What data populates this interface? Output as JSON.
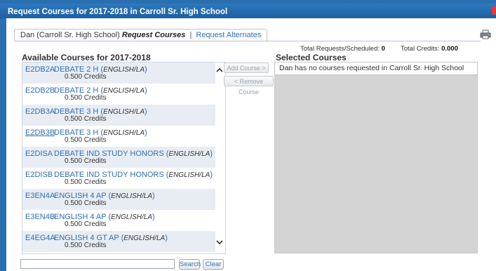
{
  "window": {
    "title": "Request Courses for 2017-2018 in Carroll Sr. High School"
  },
  "tabs": {
    "user_label": "Dan (Carroll Sr. High School)",
    "active_label": "Request Courses",
    "separator": "|",
    "alt_label": "Request Alternates"
  },
  "totals": {
    "requests_label": "Total Requests/Scheduled:",
    "requests_value": "0",
    "credits_label": "Total Credits:",
    "credits_value": "0.000"
  },
  "available": {
    "heading": "Available Courses for 2017-2018",
    "courses": [
      {
        "code": "E2DB2A",
        "name": "DEBATE 2 H",
        "dept": "ENGLISH/LA",
        "credits": "0.500 Credits"
      },
      {
        "code": "E2DB2B",
        "name": "DEBATE 2 H",
        "dept": "ENGLISH/LA",
        "credits": "0.500 Credits"
      },
      {
        "code": "E2DB3A",
        "name": "DEBATE 3 H",
        "dept": "ENGLISH/LA",
        "credits": "0.500 Credits"
      },
      {
        "code": "E2DB3B",
        "name": "DEBATE 3 H",
        "dept": "ENGLISH/LA",
        "credits": "0.500 Credits"
      },
      {
        "code": "E2DISA",
        "name": "DEBATE IND STUDY HONORS",
        "dept": "ENGLISH/LA",
        "credits": "0.500 Credits"
      },
      {
        "code": "E2DISB",
        "name": "DEBATE IND STUDY HONORS",
        "dept": "ENGLISH/LA",
        "credits": "0.500 Credits"
      },
      {
        "code": "E3EN4A",
        "name": "ENGLISH 4 AP",
        "dept": "ENGLISH/LA",
        "credits": "0.500 Credits"
      },
      {
        "code": "E3EN4B",
        "name": "ENGLISH 4 AP",
        "dept": "ENGLISH/LA",
        "credits": "0.500 Credits"
      },
      {
        "code": "E4EG4A",
        "name": "ENGLISH 4 GT AP",
        "dept": "ENGLISH/LA",
        "credits": "0.500 Credits"
      }
    ]
  },
  "actions": {
    "add": "Add Course >",
    "remove": "< Remove Course"
  },
  "selected": {
    "heading": "Selected Courses",
    "empty_message": "Dan has no courses requested in Carroll Sr. High School"
  },
  "search": {
    "value": "",
    "button": "Search",
    "clear": "Clear"
  },
  "icons": {
    "printer": "printer-icon",
    "close": "close-icon",
    "up": "chevron-up-icon",
    "down": "chevron-down-icon"
  }
}
